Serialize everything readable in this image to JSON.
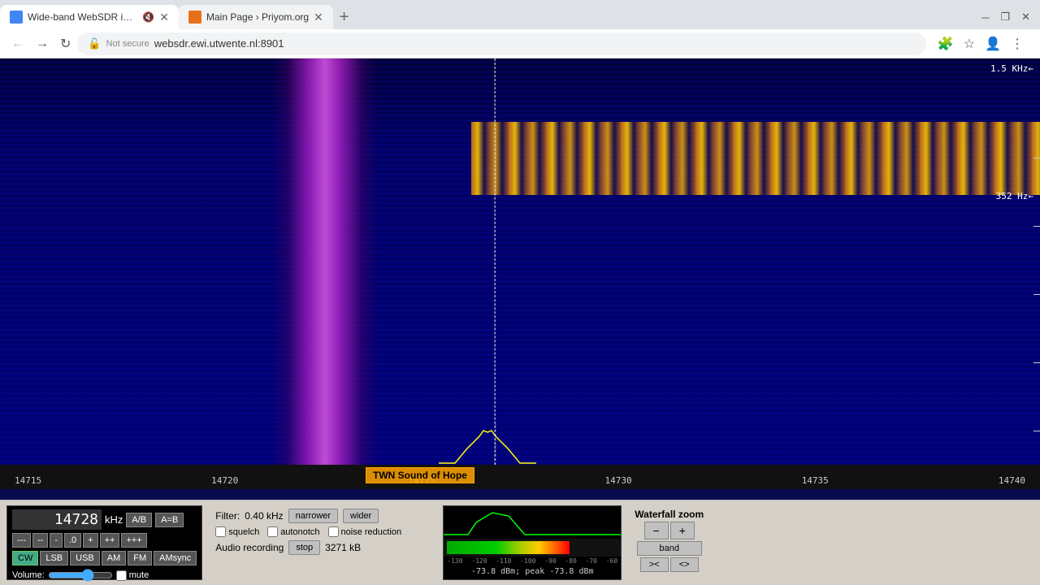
{
  "browser": {
    "tabs": [
      {
        "id": "tab1",
        "title": "Wide-band WebSDR in Ensc...",
        "favicon_color": "#4285f4",
        "active": true,
        "muted": true
      },
      {
        "id": "tab2",
        "title": "Main Page › Priyom.org",
        "favicon_color": "#e8701a",
        "active": false
      }
    ],
    "new_tab_label": "+",
    "address": "websdr.ewi.utwente.nl:8901",
    "security": "Not secure"
  },
  "sdr": {
    "scale_top_right": "1.5 KHz←",
    "scale_right": "352 Hz←",
    "station_label": "TWN Sound of Hope",
    "freq_labels": [
      "14715",
      "14720",
      "14725",
      "14730",
      "14735",
      "14740"
    ],
    "controls": {
      "frequency": "14728",
      "freq_unit": "kHz",
      "ab_label": "A/B",
      "atob_label": "A=B",
      "tune_buttons": [
        "---",
        "--",
        "-",
        ".0",
        "+",
        "++",
        "+++"
      ],
      "mode_buttons": [
        "CW",
        "LSB",
        "USB",
        "AM",
        "FM",
        "AMsync"
      ],
      "active_mode": "CW",
      "volume_label": "Volume:",
      "mute_label": "mute",
      "filter_label": "Filter:",
      "filter_value": "0.40",
      "filter_unit": "kHz",
      "narrower_label": "narrower",
      "wider_label": "wider",
      "squelch_label": "squelch",
      "autonotch_label": "autonotch",
      "noise_reduction_label": "noise reduction",
      "audio_recording_label": "Audio recording",
      "stop_label": "stop",
      "recording_size": "3271 kB",
      "dbm_value": "-73.8 dBm; peak -73.8 dBm",
      "meter_labels": [
        "-130",
        "-120",
        "-110",
        "-100",
        "-90",
        "-80",
        "-70",
        "-60"
      ],
      "waterfall_zoom_title": "Waterfall zoom",
      "zoom_minus": "−",
      "zoom_plus": "+",
      "zoom_band": "band",
      "zoom_left": "><",
      "zoom_right": "<>"
    }
  }
}
